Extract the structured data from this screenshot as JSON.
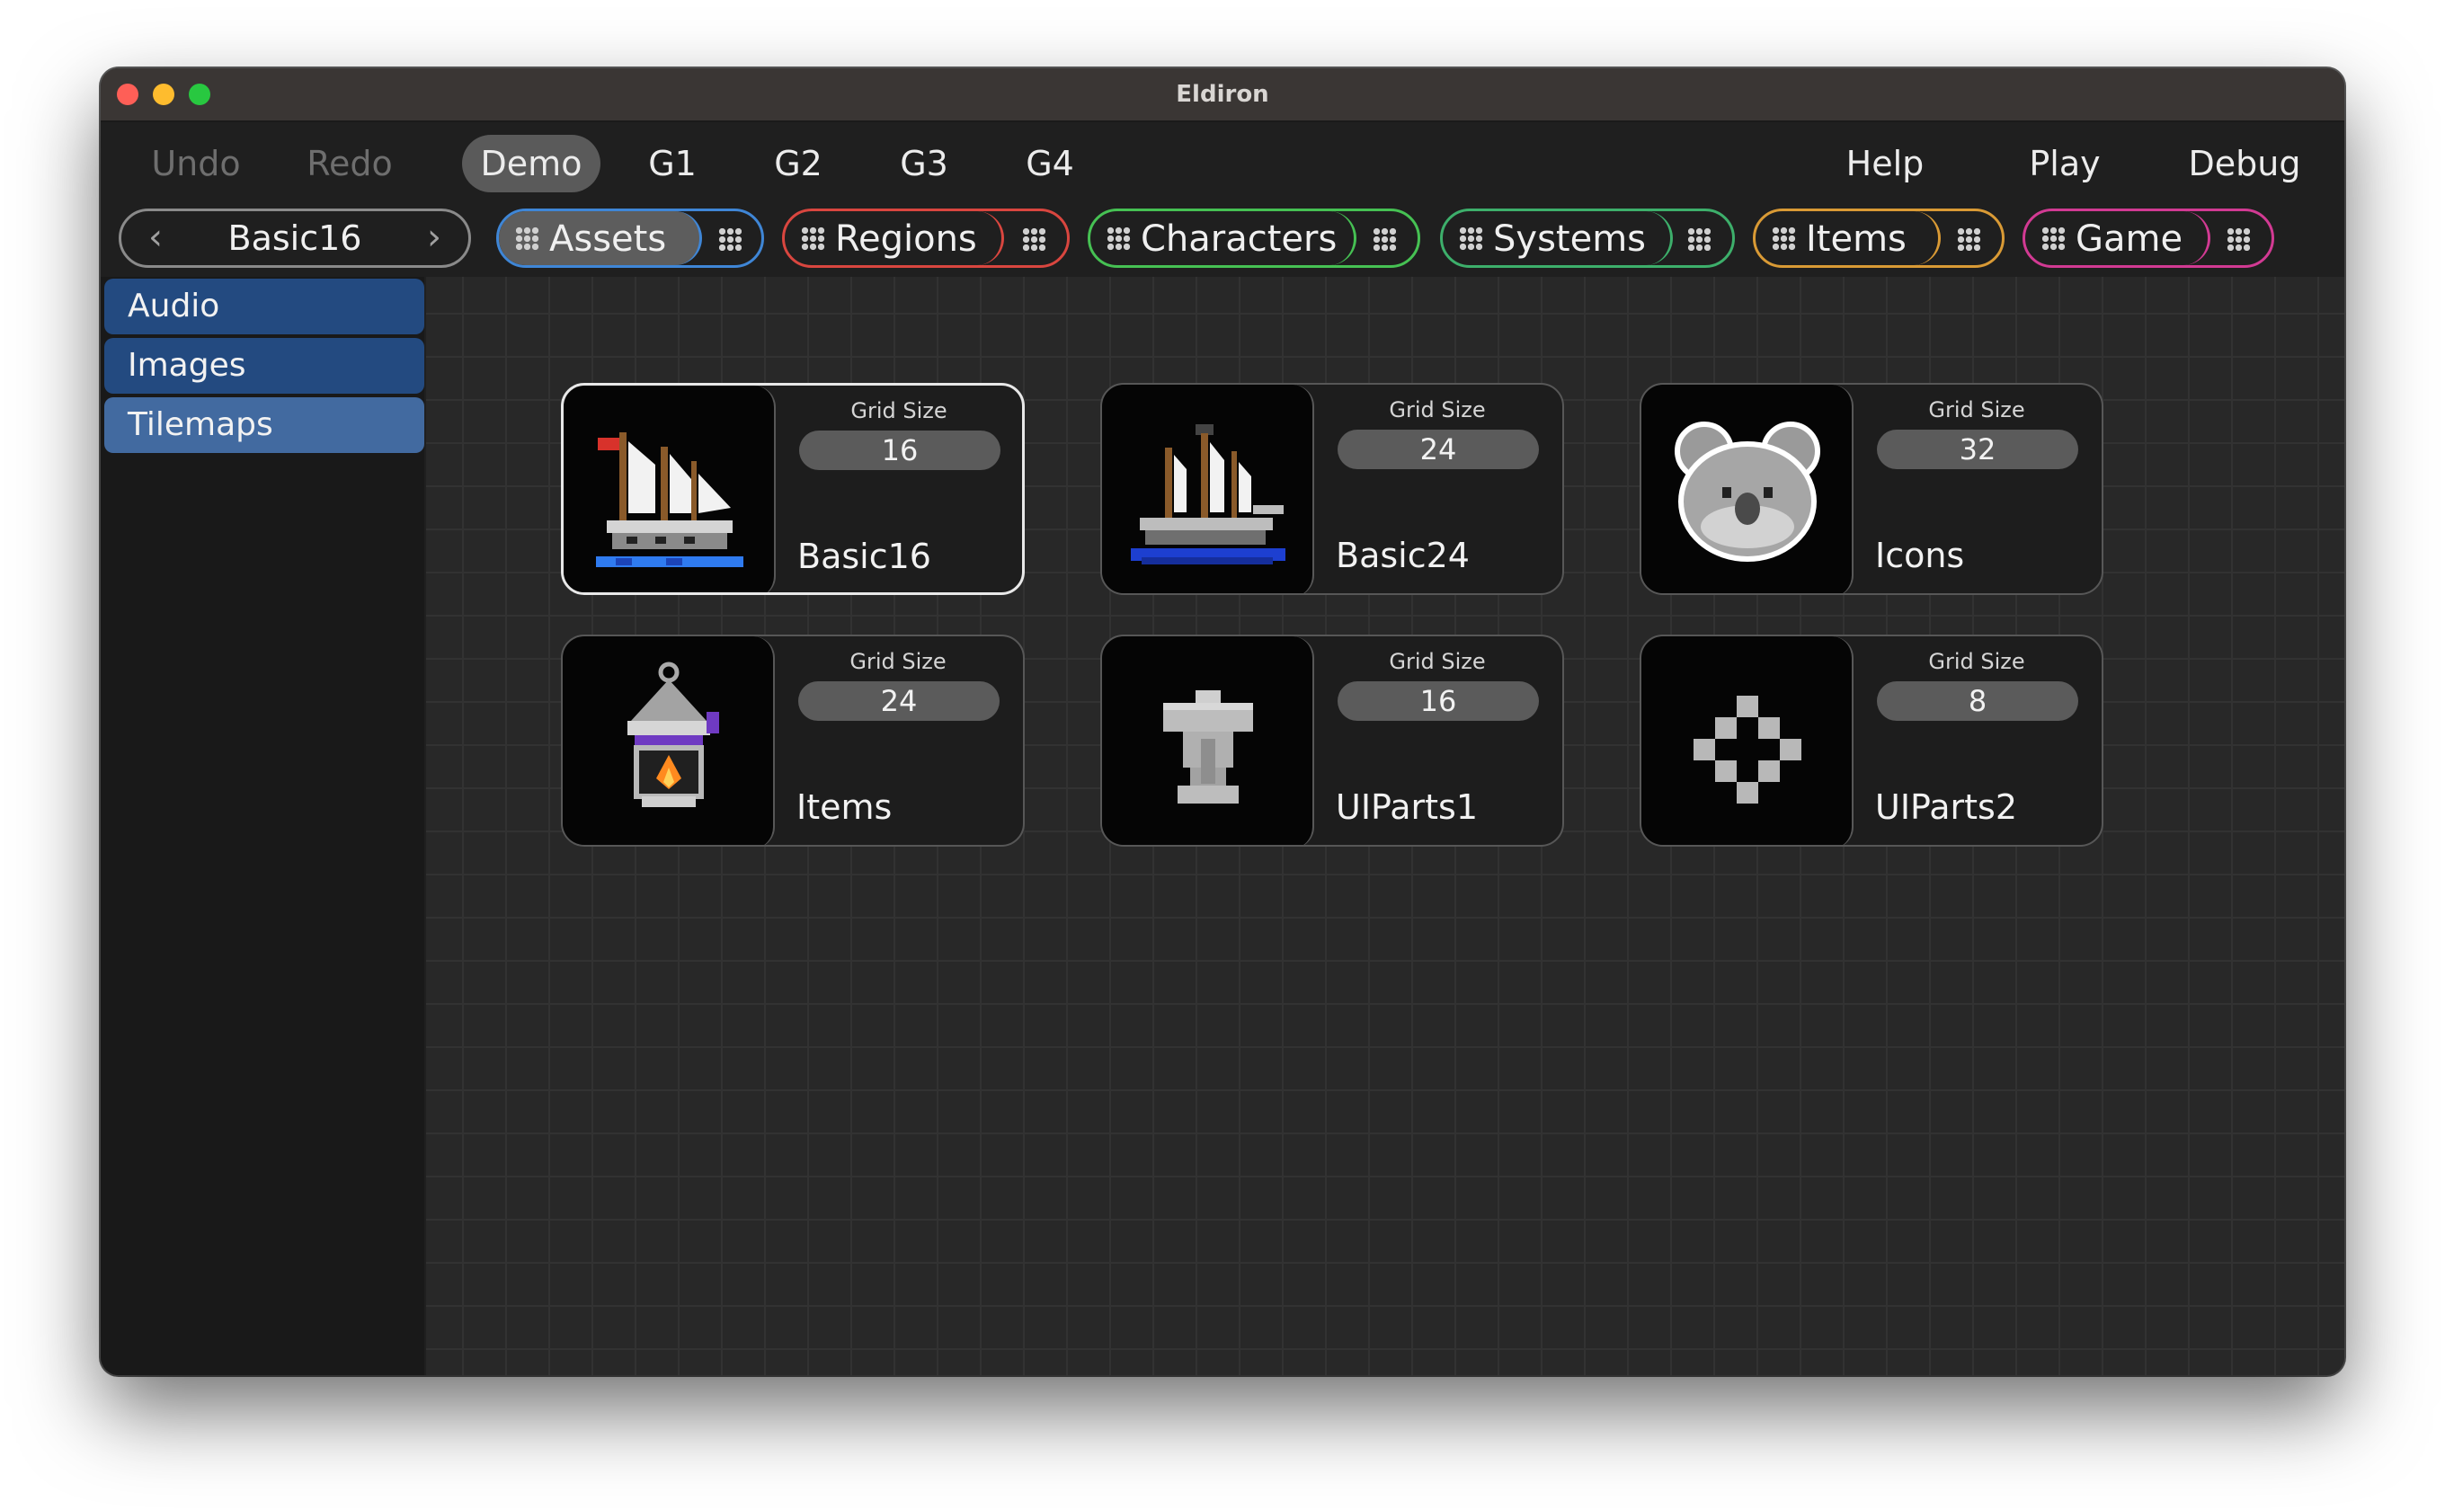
{
  "window": {
    "title": "Eldiron"
  },
  "menu": {
    "undo": "Undo",
    "redo": "Redo",
    "demo": "Demo",
    "g1": "G1",
    "g2": "G2",
    "g3": "G3",
    "g4": "G4",
    "help": "Help",
    "play": "Play",
    "debug": "Debug"
  },
  "nav": {
    "current": "Basic16",
    "prev_icon": "chevron-left-icon",
    "next_icon": "chevron-right-icon"
  },
  "tabs": [
    {
      "label": "Assets",
      "color": "#3f86d6",
      "selected": true
    },
    {
      "label": "Regions",
      "color": "#d9463f"
    },
    {
      "label": "Characters",
      "color": "#46c153"
    },
    {
      "label": "Systems",
      "color": "#3daf6b"
    },
    {
      "label": "Items",
      "color": "#d99a35"
    },
    {
      "label": "Game",
      "color": "#d23a93"
    }
  ],
  "sidebar": {
    "items": [
      {
        "label": "Audio"
      },
      {
        "label": "Images"
      },
      {
        "label": "Tilemaps",
        "selected": true
      }
    ]
  },
  "tilemaps": [
    {
      "name": "Basic16",
      "grid_label": "Grid Size",
      "grid_size": "16",
      "icon": "sailing-ship-icon",
      "selected": true
    },
    {
      "name": "Basic24",
      "grid_label": "Grid Size",
      "grid_size": "24",
      "icon": "pirate-ship-icon"
    },
    {
      "name": "Icons",
      "grid_label": "Grid Size",
      "grid_size": "32",
      "icon": "koala-icon"
    },
    {
      "name": "Items",
      "grid_label": "Grid Size",
      "grid_size": "24",
      "icon": "lantern-icon"
    },
    {
      "name": "UIParts1",
      "grid_label": "Grid Size",
      "grid_size": "16",
      "icon": "ui-part-icon"
    },
    {
      "name": "UIParts2",
      "grid_label": "Grid Size",
      "grid_size": "8",
      "icon": "diamond-pattern-icon"
    }
  ]
}
